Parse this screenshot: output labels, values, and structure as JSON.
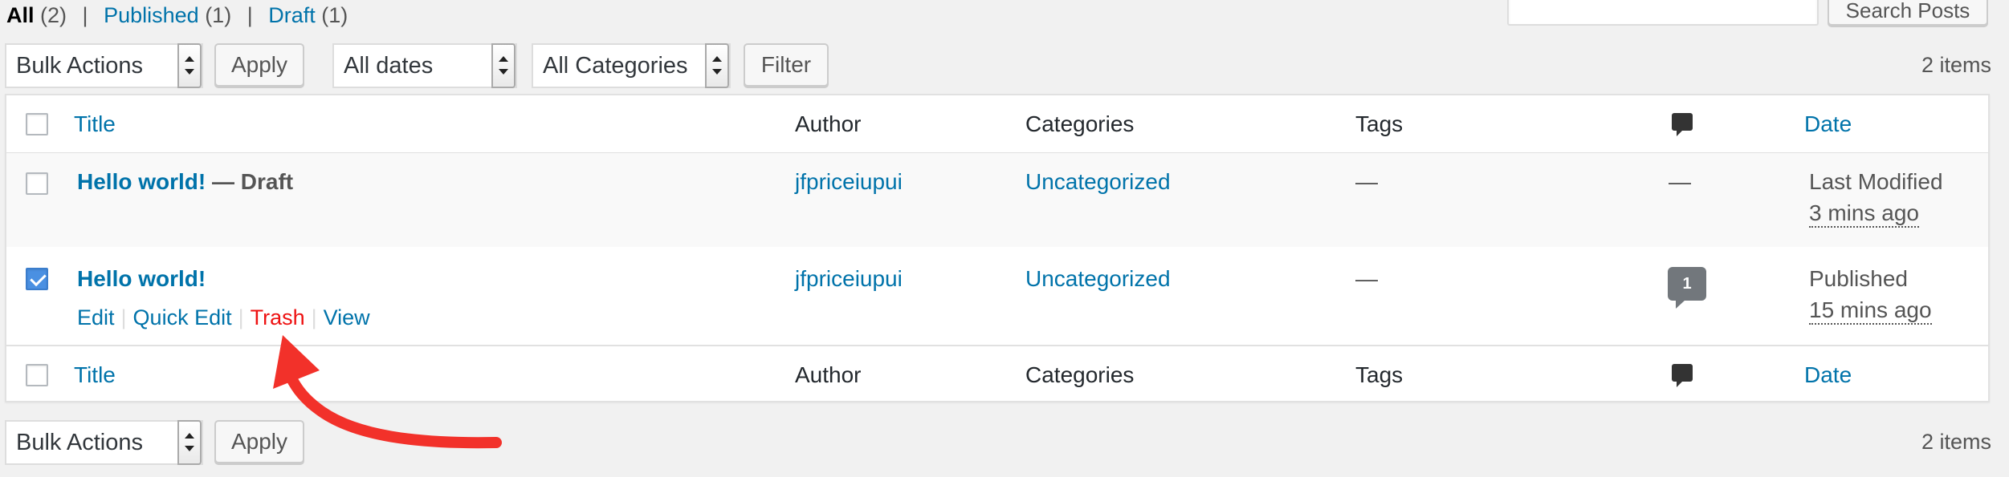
{
  "views": {
    "all_label": "All",
    "all_count": "(2)",
    "published_label": "Published",
    "published_count": "(1)",
    "draft_label": "Draft",
    "draft_count": "(1)",
    "separator": "|"
  },
  "search": {
    "input_value": "",
    "button_label": "Search Posts"
  },
  "top_nav": {
    "bulk_actions": "Bulk Actions",
    "apply": "Apply",
    "dates_filter": "All dates",
    "category_filter": "All Categories",
    "filter": "Filter",
    "items_count": "2 items"
  },
  "table": {
    "columns": {
      "title": "Title",
      "author": "Author",
      "categories": "Categories",
      "tags": "Tags",
      "comments_icon": "comment-icon",
      "date": "Date"
    },
    "rows": [
      {
        "title": "Hello world!",
        "state": "— Draft",
        "author": "jfpriceiupui",
        "category": "Uncategorized",
        "tags": "—",
        "comments": "—",
        "date_status": "Last Modified",
        "date_ago": "3 mins ago",
        "checked": false
      },
      {
        "title": "Hello world!",
        "state": "",
        "author": "jfpriceiupui",
        "category": "Uncategorized",
        "tags": "—",
        "comments": "1",
        "date_status": "Published",
        "date_ago": "15 mins ago",
        "checked": true,
        "row_actions": {
          "edit": "Edit",
          "quick_edit": "Quick Edit",
          "trash": "Trash",
          "view": "View",
          "separator": "|"
        }
      }
    ]
  },
  "bottom_nav": {
    "bulk_actions": "Bulk Actions",
    "apply": "Apply",
    "items_count": "2 items"
  },
  "colors": {
    "link": "#0073aa",
    "trash_highlight": "#e11",
    "annotation_arrow": "#f2312a",
    "checkbox_checked": "#4a90e2"
  }
}
